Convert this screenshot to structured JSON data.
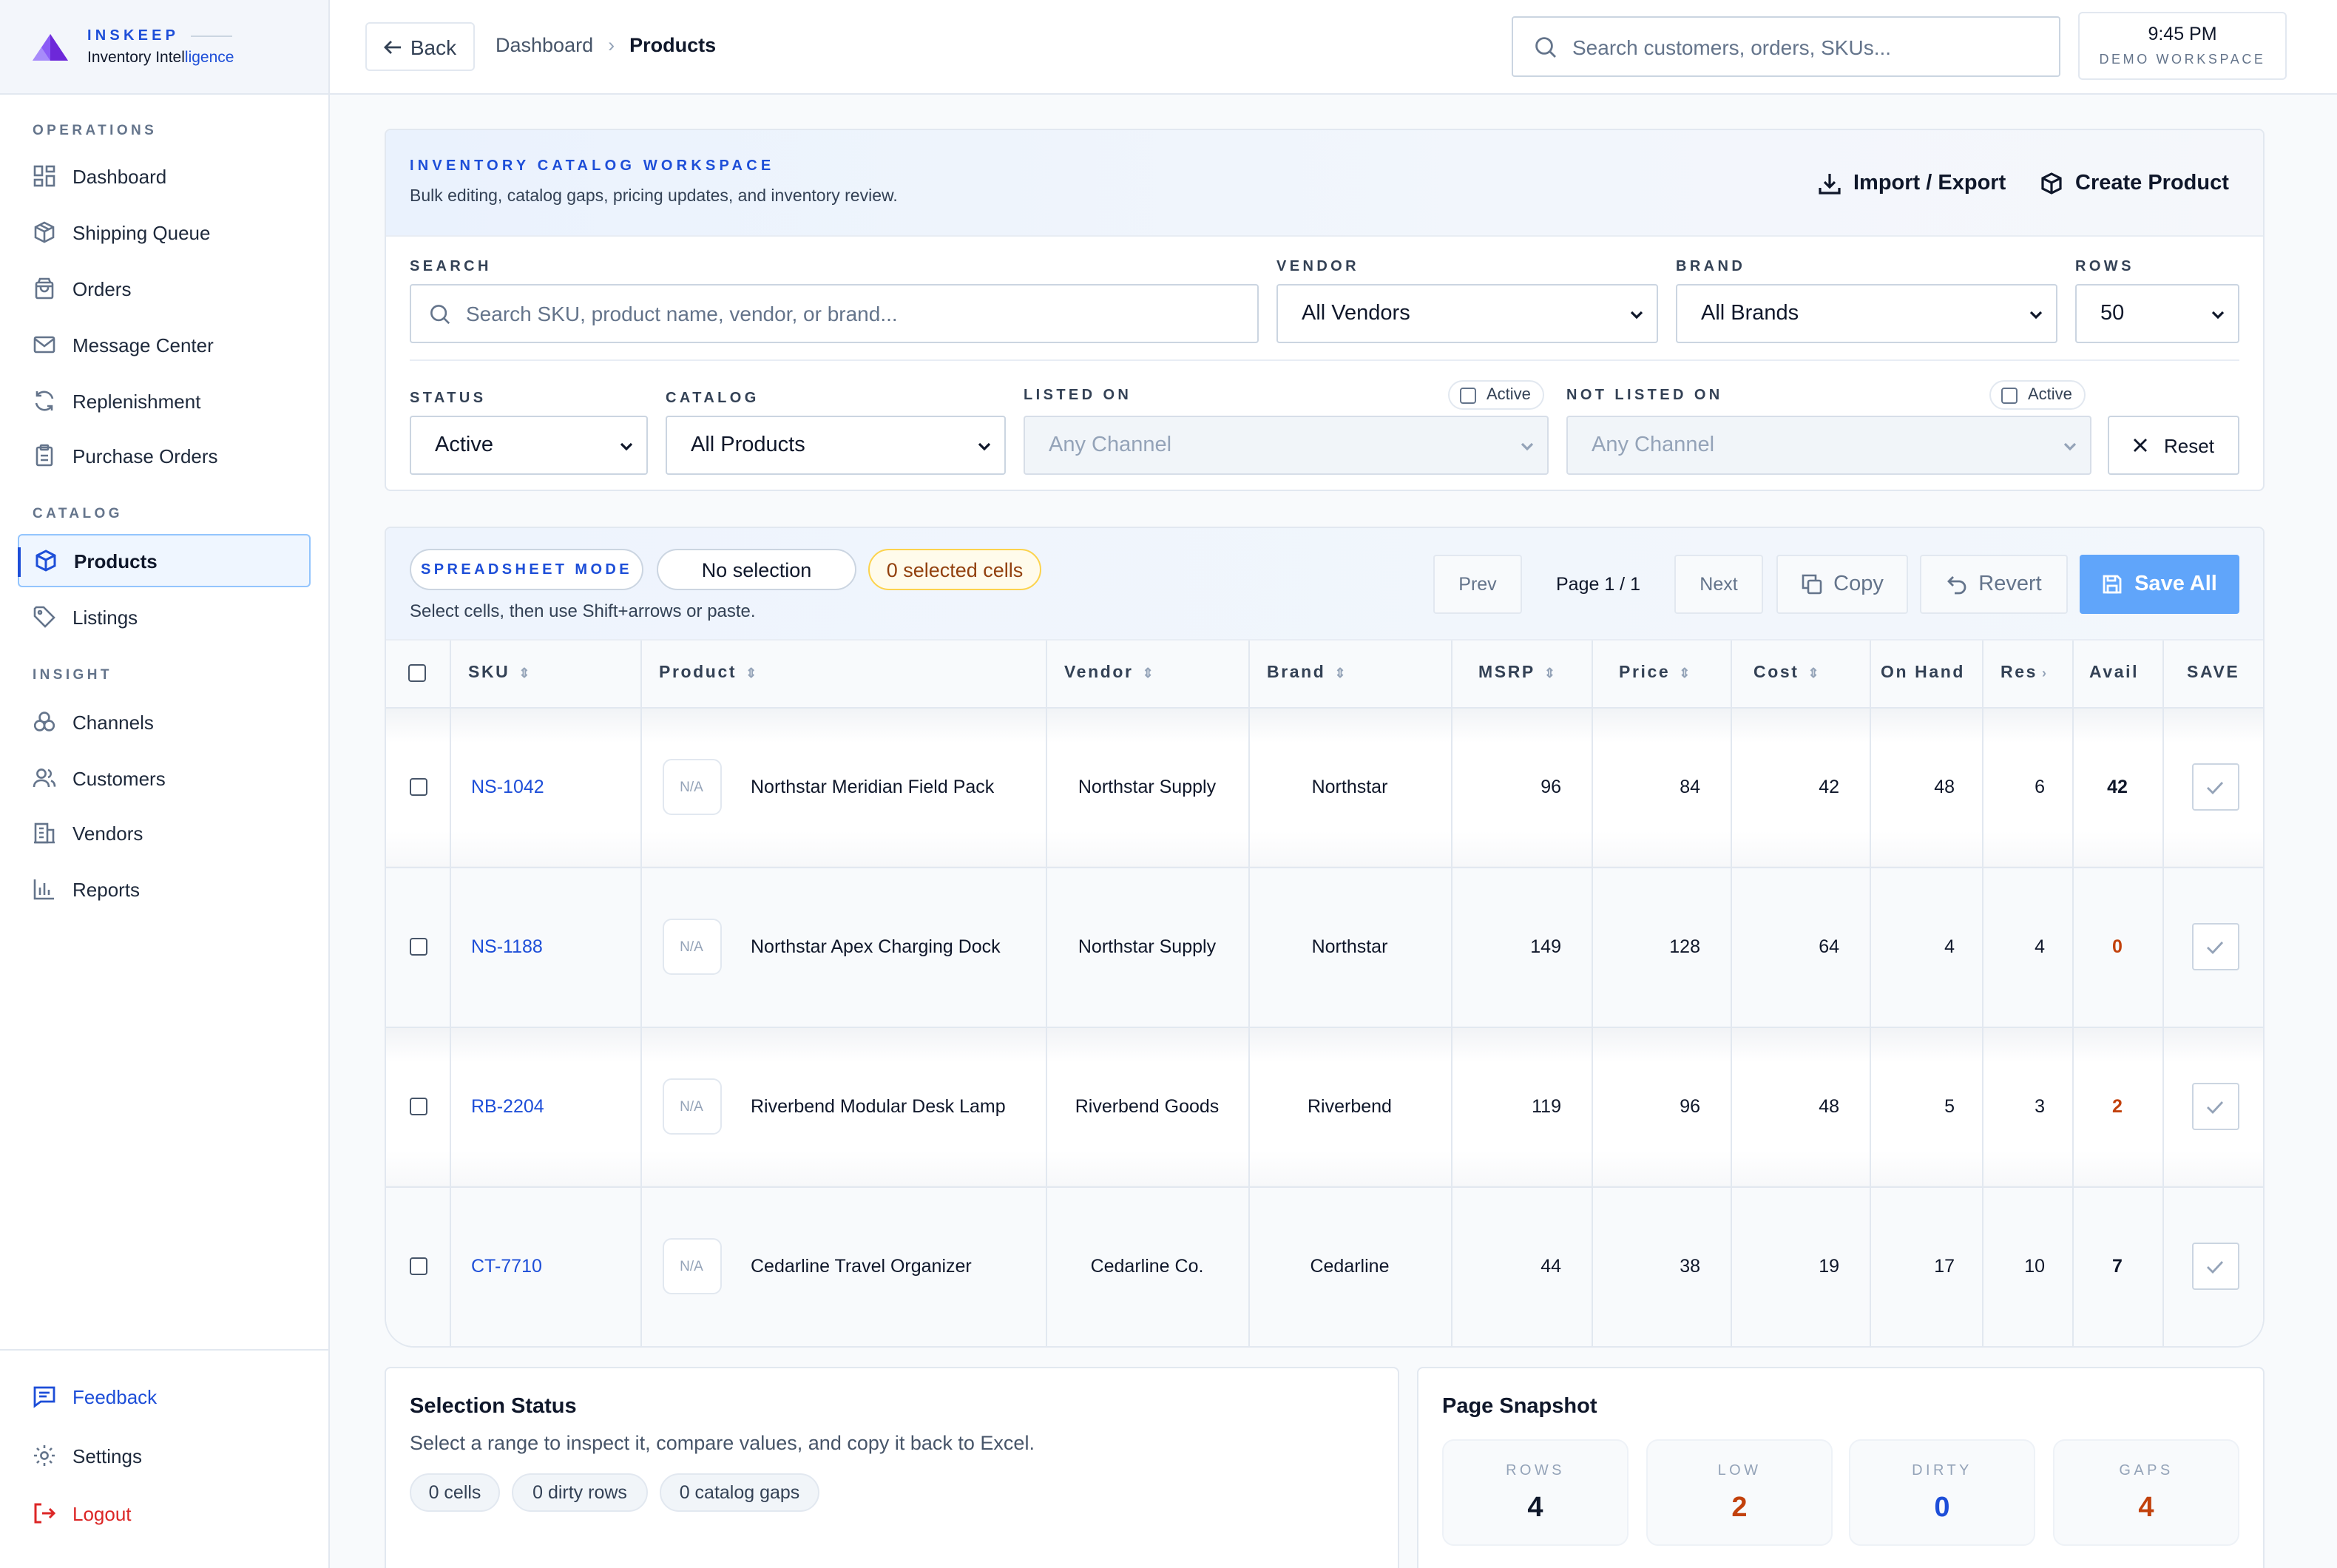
{
  "brand": {
    "name": "INSKEEP",
    "subtitle_main": "Inventory Intel",
    "subtitle_accent": "ligence"
  },
  "sidebar": {
    "sections": [
      {
        "label": "OPERATIONS"
      },
      {
        "label": "CATALOG"
      },
      {
        "label": "INSIGHT"
      }
    ],
    "items": [
      {
        "label": "Dashboard",
        "icon": "dashboard-icon"
      },
      {
        "label": "Shipping Queue",
        "icon": "package-icon"
      },
      {
        "label": "Orders",
        "icon": "shopping-bag-icon"
      },
      {
        "label": "Message Center",
        "icon": "mail-icon"
      },
      {
        "label": "Replenishment",
        "icon": "refresh-icon"
      },
      {
        "label": "Purchase Orders",
        "icon": "clipboard-icon"
      },
      {
        "label": "Products",
        "icon": "box-icon",
        "active": true
      },
      {
        "label": "Listings",
        "icon": "tag-icon"
      },
      {
        "label": "Channels",
        "icon": "channels-icon"
      },
      {
        "label": "Customers",
        "icon": "users-icon"
      },
      {
        "label": "Vendors",
        "icon": "building-icon"
      },
      {
        "label": "Reports",
        "icon": "bar-chart-icon"
      }
    ],
    "footer": [
      {
        "label": "Feedback",
        "icon": "feedback-icon",
        "color": "#1d4ed8"
      },
      {
        "label": "Settings",
        "icon": "gear-icon",
        "color": "#0f172a"
      },
      {
        "label": "Logout",
        "icon": "logout-icon",
        "color": "#dc2626"
      }
    ]
  },
  "topbar": {
    "back_label": "Back",
    "breadcrumb": [
      "Dashboard",
      "Products"
    ],
    "search_placeholder": "Search customers, orders, SKUs...",
    "time": "9:45 PM",
    "workspace": "DEMO WORKSPACE"
  },
  "filters": {
    "title": "INVENTORY CATALOG WORKSPACE",
    "subtitle": "Bulk editing, catalog gaps, pricing updates, and inventory review.",
    "import_export_label": "Import / Export",
    "create_label": "Create Product",
    "search_label": "SEARCH",
    "search_placeholder": "Search SKU, product name, vendor, or brand...",
    "vendor_label": "VENDOR",
    "vendor_value": "All Vendors",
    "brand_label": "BRAND",
    "brand_value": "All Brands",
    "rows_label": "ROWS",
    "rows_value": "50",
    "status_label": "STATUS",
    "status_value": "Active",
    "catalog_label": "CATALOG",
    "catalog_value": "All Products",
    "listed_on_label": "LISTED ON",
    "listed_on_value": "Any Channel",
    "listed_active_label": "Active",
    "not_listed_label": "NOT LISTED ON",
    "not_listed_value": "Any Channel",
    "not_listed_active_label": "Active",
    "reset_label": "Reset"
  },
  "grid": {
    "mode_label": "SPREADSHEET MODE",
    "selection_label": "No selection",
    "cells_label": "0 selected cells",
    "hint": "Select cells, then use Shift+arrows or paste.",
    "prev_label": "Prev",
    "page_label": "Page 1 / 1",
    "next_label": "Next",
    "copy_label": "Copy",
    "revert_label": "Revert",
    "save_label": "Save All",
    "columns": [
      "SKU",
      "Product",
      "Vendor",
      "Brand",
      "MSRP",
      "Price",
      "Cost",
      "On Hand",
      "Res",
      "Avail",
      "SAVE"
    ],
    "thumb_label": "N/A",
    "rows": [
      {
        "sku": "NS-1042",
        "product": "Northstar Meridian Field Pack",
        "vendor": "Northstar Supply",
        "brand": "Northstar",
        "msrp": "96",
        "price": "84",
        "cost": "42",
        "on_hand": "48",
        "res": "6",
        "avail": "42",
        "avail_color": "#0f172a"
      },
      {
        "sku": "NS-1188",
        "product": "Northstar Apex Charging Dock",
        "vendor": "Northstar Supply",
        "brand": "Northstar",
        "msrp": "149",
        "price": "128",
        "cost": "64",
        "on_hand": "4",
        "res": "4",
        "avail": "0",
        "avail_color": "#c2410c"
      },
      {
        "sku": "RB-2204",
        "product": "Riverbend Modular Desk Lamp",
        "vendor": "Riverbend Goods",
        "brand": "Riverbend",
        "msrp": "119",
        "price": "96",
        "cost": "48",
        "on_hand": "5",
        "res": "3",
        "avail": "2",
        "avail_color": "#c2410c"
      },
      {
        "sku": "CT-7710",
        "product": "Cedarline Travel Organizer",
        "vendor": "Cedarline Co.",
        "brand": "Cedarline",
        "msrp": "44",
        "price": "38",
        "cost": "19",
        "on_hand": "17",
        "res": "10",
        "avail": "7",
        "avail_color": "#0f172a"
      }
    ]
  },
  "selection_status": {
    "title": "Selection Status",
    "description": "Select a range to inspect it, compare values, and copy it back to Excel.",
    "chips": [
      "0 cells",
      "0 dirty rows",
      "0 catalog gaps"
    ]
  },
  "page_snapshot": {
    "title": "Page Snapshot",
    "stats": [
      {
        "label": "ROWS",
        "value": "4",
        "color": "#0f172a"
      },
      {
        "label": "LOW",
        "value": "2",
        "color": "#c2410c"
      },
      {
        "label": "DIRTY",
        "value": "0",
        "color": "#1d4ed8"
      },
      {
        "label": "GAPS",
        "value": "4",
        "color": "#c2410c"
      }
    ]
  }
}
